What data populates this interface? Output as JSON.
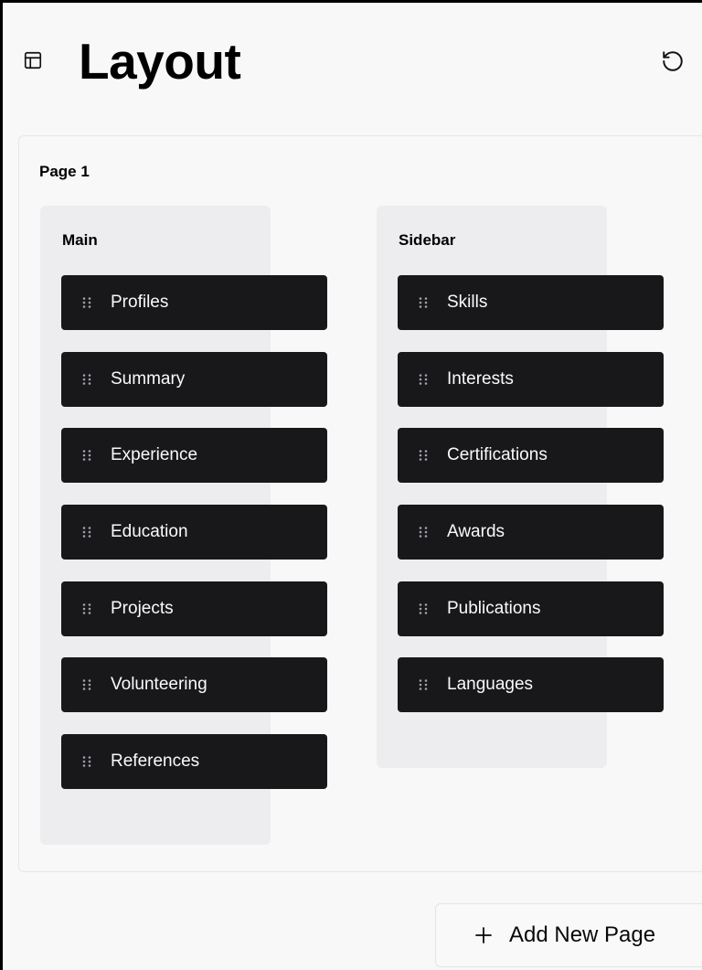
{
  "header": {
    "title": "Layout",
    "icon": "layout-icon",
    "reset_icon": "rotate-ccw-icon"
  },
  "page": {
    "title": "Page 1",
    "main": {
      "title": "Main",
      "items": [
        "Profiles",
        "Summary",
        "Experience",
        "Education",
        "Projects",
        "Volunteering",
        "References"
      ]
    },
    "sidebar": {
      "title": "Sidebar",
      "items": [
        "Skills",
        "Interests",
        "Certifications",
        "Awards",
        "Publications",
        "Languages"
      ]
    }
  },
  "actions": {
    "add_page_label": "Add New Page",
    "add_page_icon": "plus-icon"
  },
  "colors": {
    "item_background": "#18181b",
    "item_text": "#fafafa",
    "column_background": "#ededef",
    "page_background": "#f8f8f8"
  }
}
